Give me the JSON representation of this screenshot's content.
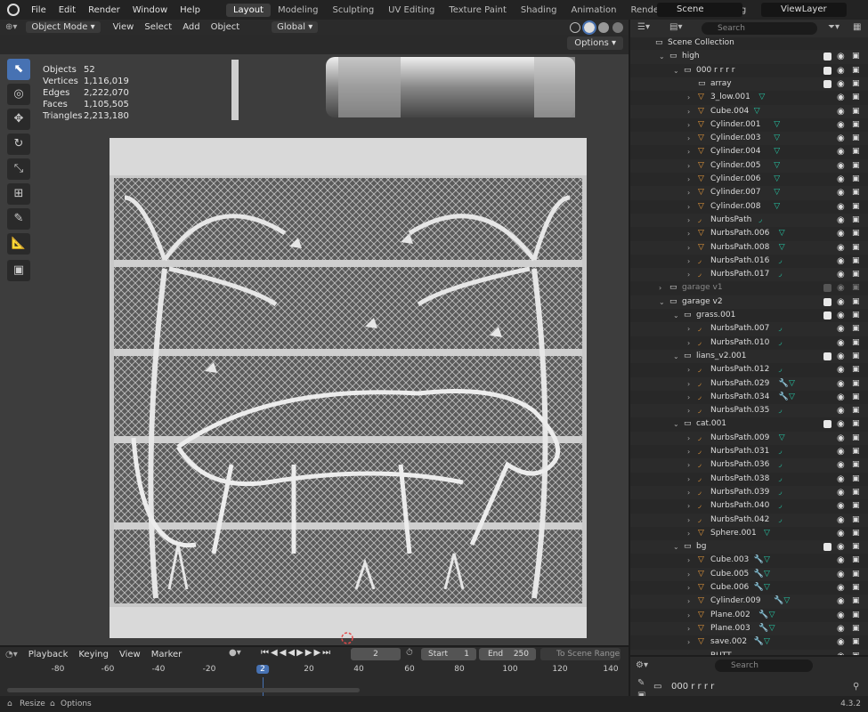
{
  "topbar": {
    "menus": [
      "File",
      "Edit",
      "Render",
      "Window",
      "Help"
    ],
    "workspaces": [
      "Layout",
      "Modeling",
      "Sculpting",
      "UV Editing",
      "Texture Paint",
      "Shading",
      "Animation",
      "Rendering",
      "Compositing"
    ],
    "active_workspace": "Layout",
    "scene": "Scene",
    "view_layer": "ViewLayer"
  },
  "viewport": {
    "mode": "Object Mode",
    "menus": [
      "View",
      "Select",
      "Add",
      "Object"
    ],
    "orientation": "Global",
    "options_label": "Options",
    "stats": [
      {
        "k": "Objects",
        "v": "52"
      },
      {
        "k": "Vertices",
        "v": "1,116,019"
      },
      {
        "k": "Edges",
        "v": "2,222,070"
      },
      {
        "k": "Faces",
        "v": "1,105,505"
      },
      {
        "k": "Triangles",
        "v": "2,213,180"
      }
    ]
  },
  "outliner": {
    "search_placeholder": "Search",
    "rows": [
      {
        "name": "Scene Collection",
        "depth": 0,
        "type": "scene",
        "arrow": "",
        "chk": null
      },
      {
        "name": "high",
        "depth": 1,
        "type": "coll",
        "arrow": "v",
        "chk": true
      },
      {
        "name": "000 r r r r",
        "depth": 2,
        "type": "coll",
        "arrow": "v",
        "chk": true
      },
      {
        "name": "array",
        "depth": 3,
        "type": "coll",
        "arrow": "",
        "chk": true
      },
      {
        "name": "3_low.001",
        "depth": 3,
        "type": "mesh",
        "arrow": ">",
        "extra": "tri",
        "chk": null
      },
      {
        "name": "Cube.004",
        "depth": 3,
        "type": "mesh",
        "arrow": ">",
        "extra": "tri",
        "chk": null
      },
      {
        "name": "Cylinder.001",
        "depth": 3,
        "type": "mesh",
        "arrow": ">",
        "extra": "tri",
        "chk": null
      },
      {
        "name": "Cylinder.003",
        "depth": 3,
        "type": "mesh",
        "arrow": ">",
        "extra": "tri",
        "chk": null
      },
      {
        "name": "Cylinder.004",
        "depth": 3,
        "type": "mesh",
        "arrow": ">",
        "extra": "tri",
        "chk": null
      },
      {
        "name": "Cylinder.005",
        "depth": 3,
        "type": "mesh",
        "arrow": ">",
        "extra": "tri",
        "chk": null
      },
      {
        "name": "Cylinder.006",
        "depth": 3,
        "type": "mesh",
        "arrow": ">",
        "extra": "tri",
        "chk": null
      },
      {
        "name": "Cylinder.007",
        "depth": 3,
        "type": "mesh",
        "arrow": ">",
        "extra": "tri",
        "chk": null
      },
      {
        "name": "Cylinder.008",
        "depth": 3,
        "type": "mesh",
        "arrow": ">",
        "extra": "tri",
        "chk": null
      },
      {
        "name": "NurbsPath",
        "depth": 3,
        "type": "curve",
        "arrow": ">",
        "extra": "curve",
        "chk": null
      },
      {
        "name": "NurbsPath.006",
        "depth": 3,
        "type": "mesh",
        "arrow": ">",
        "extra": "tri",
        "chk": null
      },
      {
        "name": "NurbsPath.008",
        "depth": 3,
        "type": "mesh",
        "arrow": ">",
        "extra": "tri",
        "chk": null
      },
      {
        "name": "NurbsPath.016",
        "depth": 3,
        "type": "curve",
        "arrow": ">",
        "extra": "curve",
        "chk": null
      },
      {
        "name": "NurbsPath.017",
        "depth": 3,
        "type": "curve",
        "arrow": ">",
        "extra": "curve",
        "chk": null
      },
      {
        "name": "garage v1",
        "depth": 1,
        "type": "coll",
        "arrow": ">",
        "chk": false,
        "dim": true
      },
      {
        "name": "garage v2",
        "depth": 1,
        "type": "coll",
        "arrow": "v",
        "chk": true
      },
      {
        "name": "grass.001",
        "depth": 2,
        "type": "coll",
        "arrow": "v",
        "chk": true
      },
      {
        "name": "NurbsPath.007",
        "depth": 3,
        "type": "curve",
        "arrow": ">",
        "extra": "curve",
        "chk": null
      },
      {
        "name": "NurbsPath.010",
        "depth": 3,
        "type": "curve",
        "arrow": ">",
        "extra": "curve",
        "chk": null
      },
      {
        "name": "lians_v2.001",
        "depth": 2,
        "type": "coll",
        "arrow": "v",
        "chk": true
      },
      {
        "name": "NurbsPath.012",
        "depth": 3,
        "type": "curve",
        "arrow": ">",
        "extra": "curve",
        "chk": null
      },
      {
        "name": "NurbsPath.029",
        "depth": 3,
        "type": "curve",
        "arrow": ">",
        "extra": "mod",
        "chk": null
      },
      {
        "name": "NurbsPath.034",
        "depth": 3,
        "type": "curve",
        "arrow": ">",
        "extra": "mod",
        "chk": null
      },
      {
        "name": "NurbsPath.035",
        "depth": 3,
        "type": "curve",
        "arrow": ">",
        "extra": "curve",
        "chk": null
      },
      {
        "name": "cat.001",
        "depth": 2,
        "type": "coll",
        "arrow": "v",
        "chk": true
      },
      {
        "name": "NurbsPath.009",
        "depth": 3,
        "type": "curve",
        "arrow": ">",
        "extra": "tri",
        "chk": null
      },
      {
        "name": "NurbsPath.031",
        "depth": 3,
        "type": "curve",
        "arrow": ">",
        "extra": "curve",
        "chk": null
      },
      {
        "name": "NurbsPath.036",
        "depth": 3,
        "type": "curve",
        "arrow": ">",
        "extra": "curve",
        "chk": null
      },
      {
        "name": "NurbsPath.038",
        "depth": 3,
        "type": "curve",
        "arrow": ">",
        "extra": "curve",
        "chk": null
      },
      {
        "name": "NurbsPath.039",
        "depth": 3,
        "type": "curve",
        "arrow": ">",
        "extra": "curve",
        "chk": null
      },
      {
        "name": "NurbsPath.040",
        "depth": 3,
        "type": "curve",
        "arrow": ">",
        "extra": "curve",
        "chk": null
      },
      {
        "name": "NurbsPath.042",
        "depth": 3,
        "type": "curve",
        "arrow": ">",
        "extra": "curve",
        "chk": null
      },
      {
        "name": "Sphere.001",
        "depth": 3,
        "type": "mesh",
        "arrow": ">",
        "extra": "tri",
        "chk": null
      },
      {
        "name": "bg",
        "depth": 2,
        "type": "coll",
        "arrow": "v",
        "chk": true
      },
      {
        "name": "Cube.003",
        "depth": 3,
        "type": "mesh",
        "arrow": ">",
        "extra": "mod",
        "chk": null
      },
      {
        "name": "Cube.005",
        "depth": 3,
        "type": "mesh",
        "arrow": ">",
        "extra": "mod",
        "chk": null
      },
      {
        "name": "Cube.006",
        "depth": 3,
        "type": "mesh",
        "arrow": ">",
        "extra": "mod",
        "chk": null
      },
      {
        "name": "Cylinder.009",
        "depth": 3,
        "type": "mesh",
        "arrow": ">",
        "extra": "mod",
        "chk": null
      },
      {
        "name": "Plane.002",
        "depth": 3,
        "type": "mesh",
        "arrow": ">",
        "extra": "mod",
        "chk": null
      },
      {
        "name": "Plane.003",
        "depth": 3,
        "type": "mesh",
        "arrow": ">",
        "extra": "mod",
        "chk": null
      },
      {
        "name": "save.002",
        "depth": 3,
        "type": "mesh",
        "arrow": ">",
        "extra": "mod",
        "chk": null
      },
      {
        "name": "BUTT",
        "depth": 3,
        "type": "curve",
        "arrow": ">",
        "extra": "curve",
        "chk": null
      }
    ]
  },
  "properties": {
    "search_placeholder": "Search",
    "object_name": "000 r r r r"
  },
  "timeline": {
    "menus": [
      "Playback",
      "Keying",
      "View",
      "Marker"
    ],
    "current_frame": "2",
    "start_label": "Start",
    "start": "1",
    "end_label": "End",
    "end": "250",
    "range_label": "To Scene Range",
    "ruler": [
      "-80",
      "-60",
      "-40",
      "-20",
      "2",
      "20",
      "40",
      "60",
      "80",
      "100",
      "120",
      "140"
    ]
  },
  "statusbar": {
    "resize": "Resize",
    "options": "Options",
    "version": "4.3.2"
  }
}
